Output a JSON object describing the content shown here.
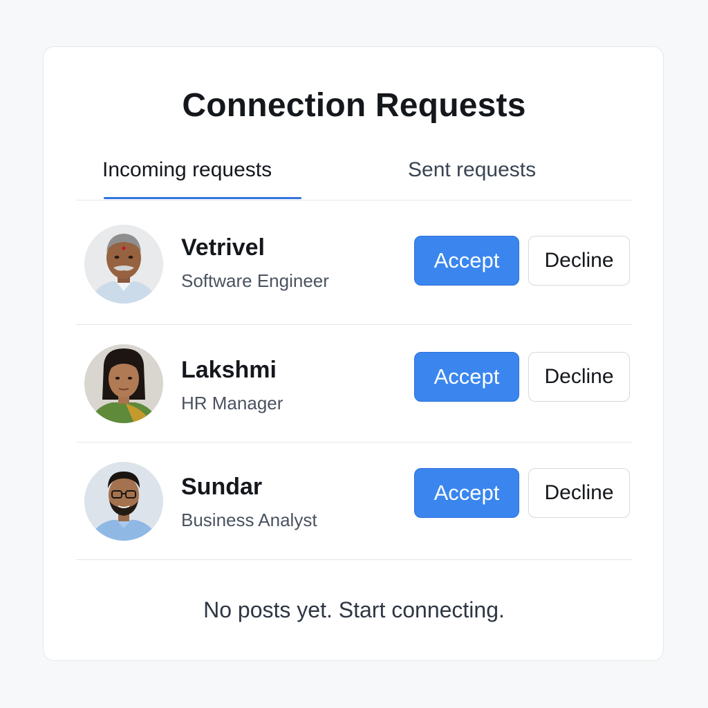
{
  "page": {
    "title": "Connection Requests",
    "empty_message": "No posts yet. Start connecting."
  },
  "tabs": [
    {
      "label": "Incoming requests",
      "active": true
    },
    {
      "label": "Sent requests",
      "active": false
    }
  ],
  "requests": [
    {
      "name": "Vetrivel",
      "role": "Software Engineer",
      "accept_label": "Accept",
      "decline_label": "Decline"
    },
    {
      "name": "Lakshmi",
      "role": "HR Manager",
      "accept_label": "Accept",
      "decline_label": "Decline"
    },
    {
      "name": "Sundar",
      "role": "Business Analyst",
      "accept_label": "Accept",
      "decline_label": "Decline"
    }
  ],
  "colors": {
    "accent": "#3a86ee",
    "tab_underline": "#2f73e0",
    "card_background": "#ffffff",
    "page_background": "#f7f8f9"
  }
}
